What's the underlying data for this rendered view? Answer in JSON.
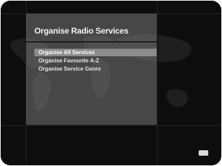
{
  "screen": {
    "title": "Organise Radio Services",
    "menu": [
      {
        "label": "Organise All Services",
        "selected": true
      },
      {
        "label": "Organise Favourite A-Z",
        "selected": false
      },
      {
        "label": "Organise Service Genre",
        "selected": false
      }
    ]
  },
  "colors": {
    "background": "#0b0b0b",
    "panel": "#787878",
    "highlight": "#8c8c8c",
    "text": "#f2f2f2"
  }
}
